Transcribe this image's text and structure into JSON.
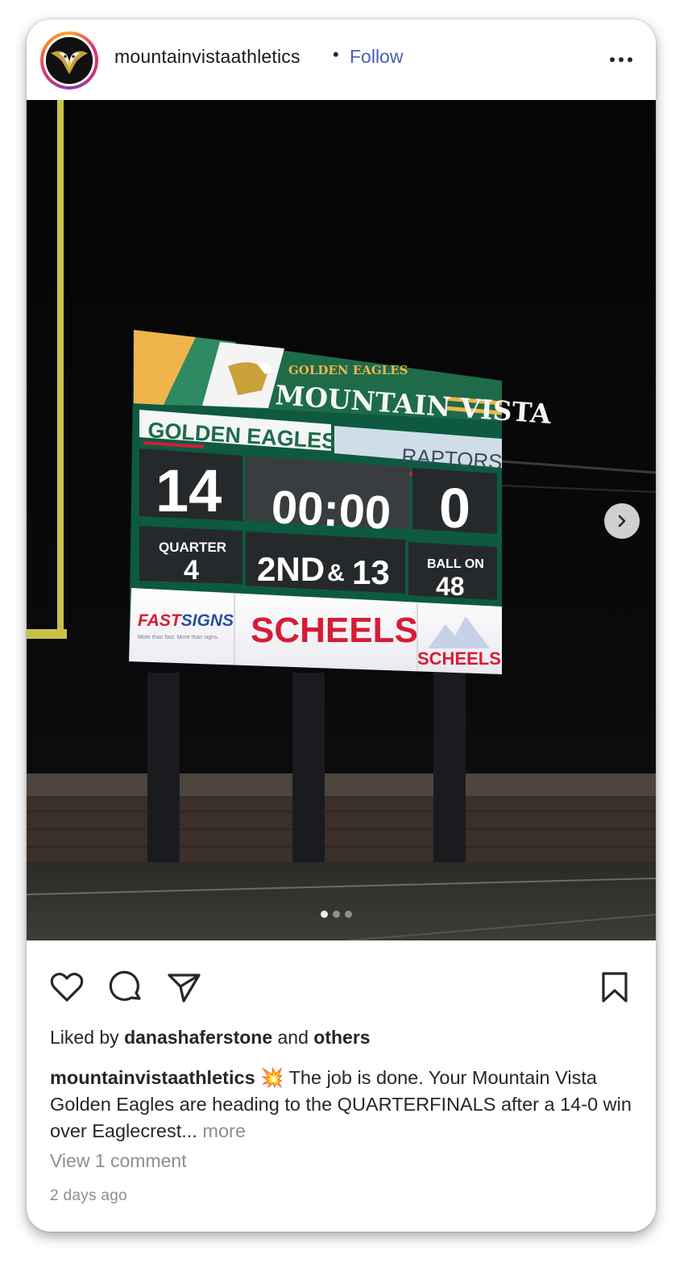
{
  "post": {
    "username": "mountainvistaathletics",
    "separator": "•",
    "follow_label": "Follow",
    "more_icon": "more-horizontal-icon"
  },
  "scoreboard": {
    "header_small": "GOLDEN EAGLES",
    "header_big": "MOUNTAIN VISTA",
    "home_name": "GOLDEN EAGLES",
    "away_name": "RAPTORS",
    "home_score": "14",
    "away_score": "0",
    "clock": "00:00",
    "quarter_label": "QUARTER",
    "quarter_value": "4",
    "down": "2ND",
    "down_amp": "&",
    "to_go": "13",
    "ball_on_label": "BALL ON",
    "ball_on_value": "48",
    "sponsor1": "FASTSIGNS",
    "sponsor1_fast": "FAST",
    "sponsor1_signs": "SIGNS",
    "sponsor1_tagline": "More than fast. More than signs.",
    "sponsor2": "SCHEELS",
    "sponsor3": "SCHEELS",
    "colors": {
      "green": "#1e6b4a",
      "gold": "#f0b44c",
      "red": "#d81b35"
    }
  },
  "carousel": {
    "total": 3,
    "active": 0
  },
  "actions": {
    "like_icon": "heart-icon",
    "comment_icon": "comment-icon",
    "share_icon": "send-icon",
    "save_icon": "bookmark-icon"
  },
  "likes": {
    "prefix": "Liked by",
    "user": "danashaferstone",
    "and": "and",
    "others": "others"
  },
  "caption": {
    "username": "mountainvistaathletics",
    "emoji": "💥",
    "text": "The job is done. Your Mountain Vista Golden Eagles are heading to the QUARTERFINALS after a 14-0 win over Eaglecrest...",
    "more": "more"
  },
  "comments": {
    "view_label": "View 1 comment"
  },
  "timestamp": "2 days ago"
}
